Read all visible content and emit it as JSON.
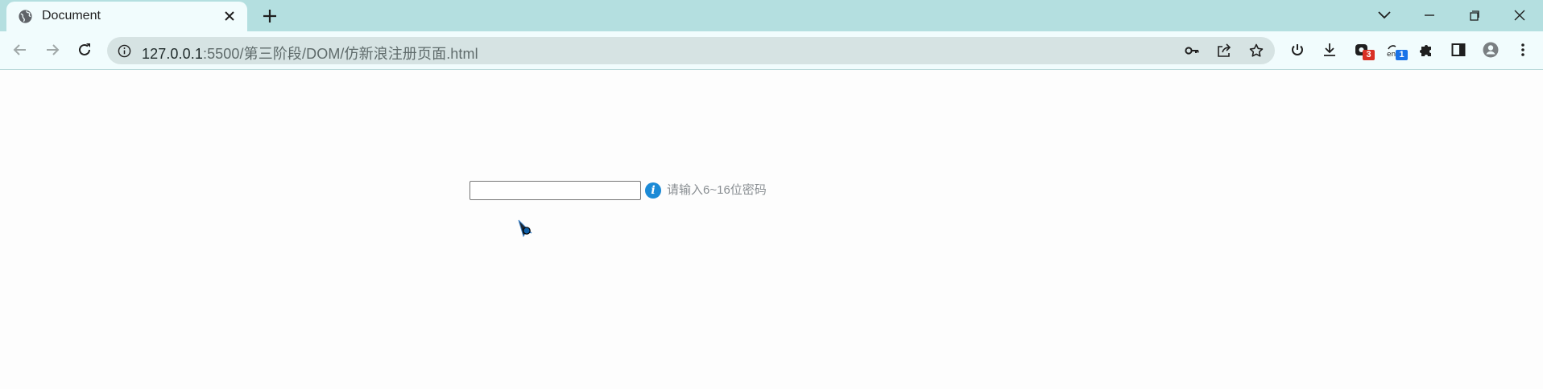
{
  "tab": {
    "title": "Document",
    "favicon": "globe-icon",
    "close_icon": "close-icon"
  },
  "window_controls": [
    "tab-search-icon",
    "minimize-icon",
    "restore-icon",
    "close-window-icon"
  ],
  "toolbar": {
    "back_icon": "back-arrow-icon",
    "forward_icon": "forward-arrow-icon",
    "reload_icon": "reload-icon"
  },
  "address_bar": {
    "host": "127.0.0.1",
    "path": ":5500/第三阶段/DOM/仿新浪注册页面.html",
    "site_info_icon": "info-icon",
    "password_icon": "key-icon",
    "share_icon": "share-icon",
    "bookmark_icon": "star-icon"
  },
  "extensions": [
    {
      "name": "power-icon"
    },
    {
      "name": "download-icon"
    },
    {
      "name": "extension-badge-icon",
      "badge": "3",
      "badge_color": "#d93025"
    },
    {
      "name": "translate-icon",
      "badge": "1",
      "badge_color": "#1a73e8"
    },
    {
      "name": "puzzle-icon"
    },
    {
      "name": "side-panel-icon"
    },
    {
      "name": "profile-avatar-icon"
    },
    {
      "name": "more-menu-icon"
    }
  ],
  "form": {
    "password_value": "",
    "hint_icon_glyph": "i",
    "hint_text": "请输入6~16位密码",
    "hint_color": "#1b8ad6"
  },
  "colors": {
    "tabstrip": "#b4dfe0",
    "toolbar": "#f1fcfd",
    "omnibox": "#d6e3e3"
  }
}
